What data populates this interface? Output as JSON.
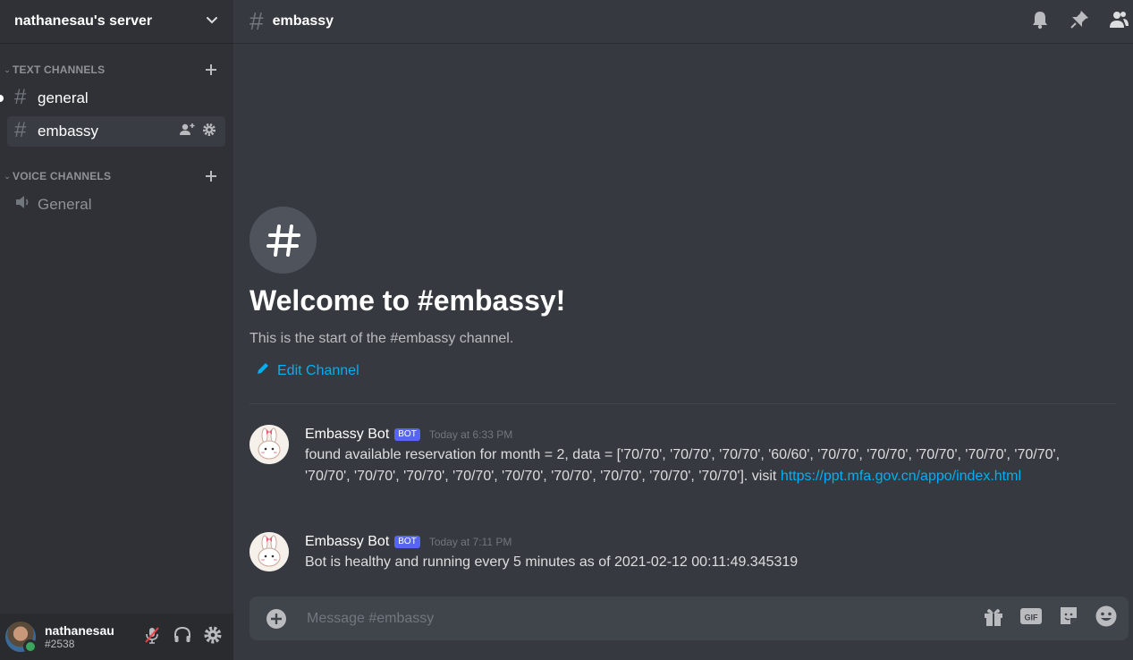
{
  "server": {
    "name": "nathanesau's server"
  },
  "sidebar": {
    "text_category": "TEXT CHANNELS",
    "voice_category": "VOICE CHANNELS",
    "text_channels": [
      {
        "name": "general"
      },
      {
        "name": "embassy"
      }
    ],
    "voice_channels": [
      {
        "name": "General"
      }
    ]
  },
  "user": {
    "name": "nathanesau",
    "tag": "#2538"
  },
  "channel": {
    "name": "embassy",
    "welcome_title": "Welcome to #embassy!",
    "welcome_sub": "This is the start of the #embassy channel.",
    "edit_label": "Edit Channel"
  },
  "messages": [
    {
      "author": "Embassy Bot",
      "badge": "BOT",
      "time": "Today at 6:33 PM",
      "text": "found available reservation for month = 2, data = ['70/70', '70/70', '70/70', '60/60', '70/70', '70/70', '70/70', '70/70', '70/70', '70/70', '70/70', '70/70', '70/70', '70/70', '70/70', '70/70', '70/70', '70/70']. visit",
      "link": "https://ppt.mfa.gov.cn/appo/index.html"
    },
    {
      "author": "Embassy Bot",
      "badge": "BOT",
      "time": "Today at 7:11 PM",
      "text": "Bot is healthy and running every 5 minutes as of 2021-02-12 00:11:49.345319"
    }
  ],
  "composer": {
    "placeholder": "Message #embassy"
  }
}
